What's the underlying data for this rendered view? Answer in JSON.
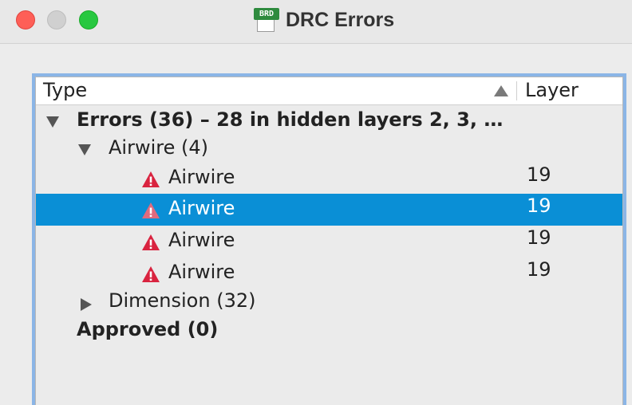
{
  "window": {
    "title": "DRC Errors",
    "icon_tag": "BRD"
  },
  "table": {
    "columns": {
      "type": "Type",
      "layer": "Layer"
    },
    "sort": {
      "column": "Type",
      "direction": "ascending"
    }
  },
  "tree": {
    "errors_group": {
      "label": "Errors (36) – 28 in hidden layers 2, 3, …",
      "expanded": true,
      "airwire_group": {
        "label": "Airwire (4)",
        "expanded": true,
        "items": [
          {
            "label": "Airwire",
            "layer": "19",
            "icon": "warning-icon",
            "selected": false
          },
          {
            "label": "Airwire",
            "layer": "19",
            "icon": "warning-icon",
            "selected": true
          },
          {
            "label": "Airwire",
            "layer": "19",
            "icon": "warning-icon",
            "selected": false
          },
          {
            "label": "Airwire",
            "layer": "19",
            "icon": "warning-icon",
            "selected": false
          }
        ]
      },
      "dimension_group": {
        "label": "Dimension (32)",
        "expanded": false
      }
    },
    "approved_group": {
      "label": "Approved (0)"
    }
  },
  "colors": {
    "selection": "#0a8fd6",
    "warning": "#d9233f",
    "focus_ring": "#8bb5e6"
  }
}
